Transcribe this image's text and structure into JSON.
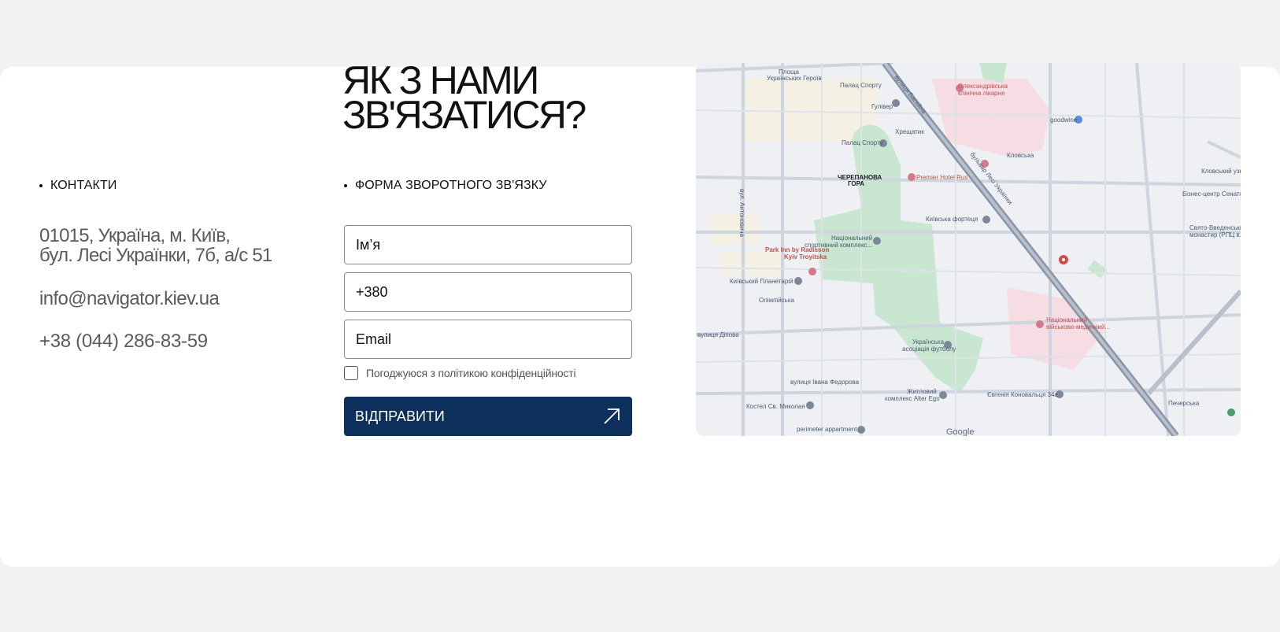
{
  "heading": {
    "line1": "ЯК З НАМИ",
    "line2": "ЗВ'ЯЗАТИСЯ?"
  },
  "contacts": {
    "label": "КОНТАКТИ",
    "address_line1": "01015, Україна, м. Київ,",
    "address_line2": "бул. Лесі Українки, 7б, а/с 51",
    "email": "info@navigator.kiev.ua",
    "phone": "+38 (044) 286-83-59"
  },
  "form": {
    "label": "ФОРМА ЗВОРОТНОГО ЗВ'ЯЗКУ",
    "name_placeholder": "Ім’я",
    "phone_placeholder": "+380",
    "email_placeholder": "Email",
    "consent_text": "Погоджуюся з політикою конфіденційності",
    "consent_checked": false,
    "submit_label": "ВІДПРАВИТИ",
    "submit_icon": "arrow-up-right-icon"
  },
  "map": {
    "provider": "Google",
    "labels": {
      "ploshcha": "Площа",
      "ukr_heroes": "Українських Героїв",
      "palats_sportu_metro": "Палац Спорту",
      "bulvar_besina": "вулиця Басейна",
      "oleksandrivska": "Олександрівська",
      "likarnia": "клінічна лікарня",
      "guliver": "Гулівер",
      "khreshchatyk": "Хрещатик",
      "goodwine": "goodwine",
      "palats_sportu": "Палац Спорту",
      "klovska": "Кловська",
      "premier": "Premier Hotel Rus",
      "cherepanova1": "ЧЕРЕПАНОВА",
      "cherepanova2": "ГОРА",
      "biznes": "Бізнес-центр Сенатор",
      "kyivska_fortetsia": "Київська фортеця",
      "natsionalnyi1": "Національний",
      "natsionalnyi2": "спортивний комплекс...",
      "park_inn1": "Park Inn by Radisson",
      "park_inn2": "Kyiv Troyitska",
      "planetarii": "Київський Планетарій",
      "olimpiiska": "Олімпійська",
      "sviato1": "Свято-Введенський",
      "sviato2": "монастир (РПЦ в...",
      "viiskovo1": "Національний",
      "viiskovo2": "військово-медичний...",
      "ukr_asotsiatsiia1": "Українська",
      "ukr_asotsiatsiia2": "асоціація футболу",
      "vul_fedorova": "вулиця Івана Федорова",
      "zhytlovyi1": "Житловий",
      "zhytlovyi2": "комплекс Alter Ego",
      "konovaltsia": "Євгенія Коновальця 34а",
      "kostel": "Костел Св. Миколая",
      "perimeter": "perimeter appartment",
      "pecherska": "Печерська",
      "google": "Google",
      "bulvar_lesi": "бульвар Лесі Українки",
      "vul_antonovycha": "вул. Антоновича",
      "vul_dipova": "вулиця Діпова",
      "klovskyi_uzv": "Кловський узв"
    }
  }
}
